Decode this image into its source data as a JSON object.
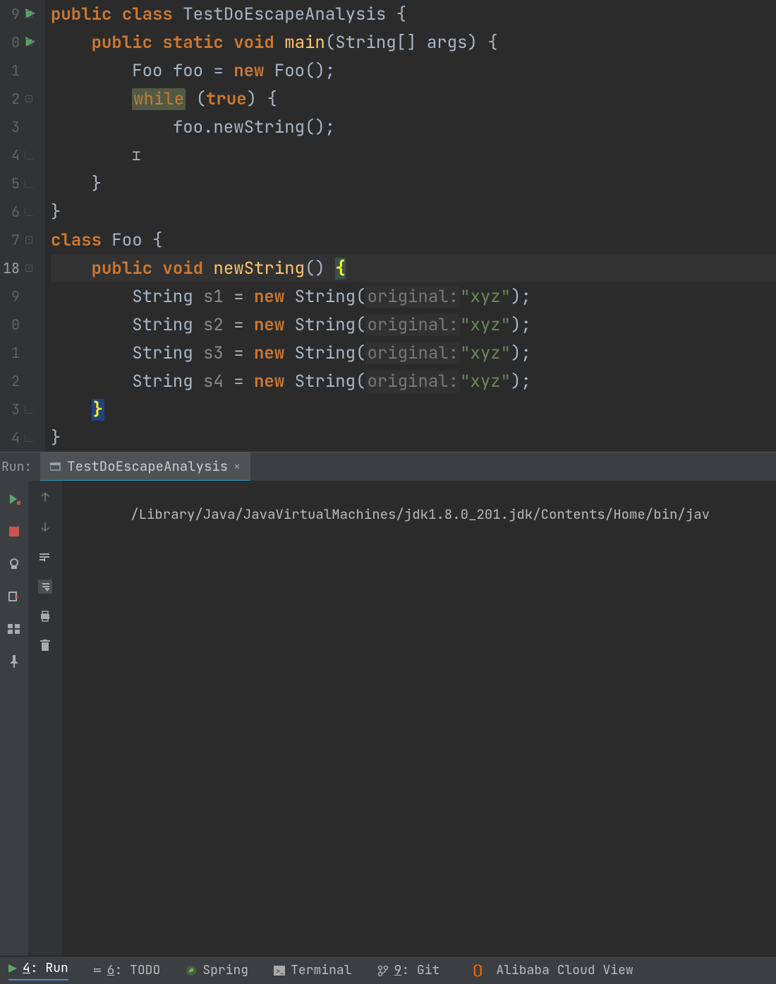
{
  "editor": {
    "lines": [
      {
        "n": "9",
        "run": true
      },
      {
        "n": "0",
        "run": true
      },
      {
        "n": "1"
      },
      {
        "n": "2"
      },
      {
        "n": "3"
      },
      {
        "n": "4"
      },
      {
        "n": "5"
      },
      {
        "n": "6"
      },
      {
        "n": "7"
      },
      {
        "n": "18"
      },
      {
        "n": "9"
      },
      {
        "n": "0"
      },
      {
        "n": "1"
      },
      {
        "n": "2"
      },
      {
        "n": "3"
      },
      {
        "n": "4"
      }
    ],
    "code": {
      "l0_public": "public ",
      "l0_class": "class ",
      "l0_name": "TestDoEscapeAnalysis ",
      "l0_brace": "{",
      "l1_pad": "    ",
      "l1_public": "public ",
      "l1_static": "static ",
      "l1_void": "void ",
      "l1_main": "main",
      "l1_args": "(String[] args) ",
      "l1_brace": "{",
      "l2_pad": "        ",
      "l2_type": "Foo ",
      "l2_var": "foo ",
      "l2_eq": "= ",
      "l2_new": "new ",
      "l2_call": "Foo();",
      "l3_pad": "        ",
      "l3_while": "while",
      "l3_paren": " (",
      "l3_true": "true",
      "l3_close": ") {",
      "l4_pad": "            ",
      "l4_call": "foo.newString();",
      "l5_pad": "        ",
      "l5_caret": "}",
      "l6_pad": "    ",
      "l6": "}",
      "l7": "}",
      "l8_class": "class ",
      "l8_name": "Foo ",
      "l8_brace": "{",
      "l9_pad": "    ",
      "l9_public": "public ",
      "l9_void": "void ",
      "l9_fn": "newString",
      "l9_paren": "() ",
      "l9_brace": "{",
      "param_hint": "original:",
      "str": "\"xyz\"",
      "s_pad": "        ",
      "s_type": "String ",
      "s_eq": " = ",
      "s_new": "new ",
      "s_call": "String(",
      "s_close": ");",
      "s1": "s1",
      "s2": "s2",
      "s3": "s3",
      "s4": "s4",
      "l14_pad": "    ",
      "l14_brace": "}",
      "l15": "}"
    }
  },
  "run_panel": {
    "label": "Run:",
    "tab": "TestDoEscapeAnalysis",
    "console_line": "/Library/Java/JavaVirtualMachines/jdk1.8.0_201.jdk/Contents/Home/bin/jav"
  },
  "bottombar": {
    "run": "4: Run",
    "todo": "6: TODO",
    "spring": "Spring",
    "terminal": "Terminal",
    "git": "9: Git",
    "alicloud": "Alibaba Cloud View"
  }
}
